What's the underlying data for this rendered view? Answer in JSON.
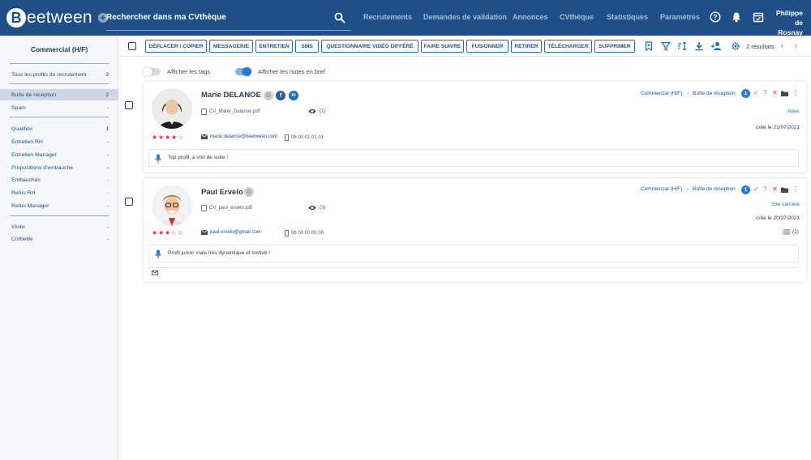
{
  "app": {
    "logo_letter": "B",
    "logo_text": "eetween",
    "logo_plus": "+",
    "search_placeholder": "Rechercher dans ma CVthèque",
    "nav": [
      "Recrutements",
      "Demandes de validation",
      "Annonces",
      "CVthèque",
      "Statistiques",
      "Paramètres"
    ],
    "user_first": "Philippe",
    "user_last": "de Rosnay"
  },
  "sidebar": {
    "title": "Commercial (H/F)",
    "items": [
      {
        "label": "Tous les profils du recrutement",
        "count": "3"
      },
      {
        "label": "Boîte de réception",
        "count": "2"
      },
      {
        "label": "Spam",
        "count": "-"
      },
      {
        "label": "Qualifiés",
        "count": "1"
      },
      {
        "label": "Entretien RH",
        "count": "-"
      },
      {
        "label": "Entretien Manager",
        "count": "-"
      },
      {
        "label": "Propositions d'embauche",
        "count": "-"
      },
      {
        "label": "Embauchés",
        "count": "-"
      },
      {
        "label": "Refus RH",
        "count": "-"
      },
      {
        "label": "Refus Manager",
        "count": "-"
      },
      {
        "label": "Vivier",
        "count": "-"
      },
      {
        "label": "Corbeille",
        "count": "-"
      }
    ]
  },
  "toolbar": {
    "buttons": [
      "DÉPLACER / COPIER",
      "MESSAGERIE",
      "ENTRETIEN",
      "SMS",
      "QUESTIONNAIRE VIDÉO DIFFÉRÉ",
      "FAIRE SUIVRE",
      "FUSIONNER",
      "RETIRER",
      "TÉLÉCHARGER",
      "SUPPRIMER"
    ],
    "results": "2 résultats",
    "prev": "‹",
    "next": "›"
  },
  "toggles": {
    "tags_label": "Afficher les tags",
    "tags_on": false,
    "notes_label": "Afficher les notes en bref",
    "notes_on": true
  },
  "candidates": [
    {
      "name": "Marie DELANOE",
      "cv_file": "CV_Marie_Delanoe.pdf",
      "views": "(2)",
      "rating": 4,
      "email": "marie.delanoe@beetween.com",
      "phone": "08 00 01 01 01",
      "note": "Top profil, à voir de suite !",
      "job": "Commercial (H/F)",
      "stage": "Boîte de réception",
      "badge": "1",
      "source": "Apec",
      "created": "créé le 21/07/2021"
    },
    {
      "name": "Paul Ervelo",
      "cv_file": "CV_paul_ervelo.pdf",
      "views": "(3)",
      "rating": 3,
      "email": "paul.ervelo@gmail.com",
      "phone": "06 00 00 00 00",
      "note": "Profil junior mais très dynamique et motivé !",
      "job": "Commercial (H/F)",
      "stage": "Boîte de réception",
      "badge": "1",
      "source": "Site carrière",
      "created": "créé le 20/07/2021",
      "tasks": "(1)"
    }
  ],
  "social_letters": {
    "google": "G",
    "facebook": "f",
    "linkedin": "in"
  },
  "stars": "★★★★★",
  "colors": {
    "primary": "#1f4f86",
    "accent": "#2a7bd1",
    "danger": "#e0323a",
    "success": "#2fa86b"
  }
}
